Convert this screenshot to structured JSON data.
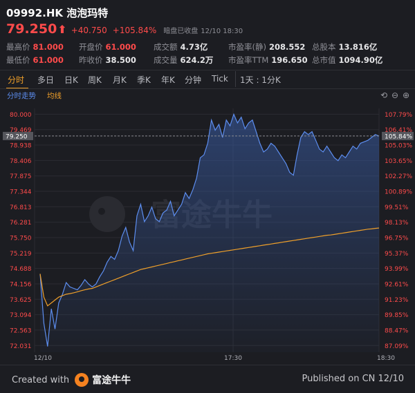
{
  "header": {
    "title": "09992.HK 泡泡玛特",
    "price": "79.250",
    "change": "+40.750",
    "change_pct": "+105.84%",
    "status": "暗盘已收盘",
    "timestamp": "12/10 18:30"
  },
  "stats": [
    {
      "label": "最高价",
      "value": "81.000",
      "red": true
    },
    {
      "label": "开盘价",
      "value": "61.000",
      "red": true
    },
    {
      "label": "成交额",
      "value": "4.73亿",
      "red": false
    },
    {
      "label": "市盈率(静)",
      "value": "208.552",
      "red": false
    },
    {
      "label": "总股本",
      "value": "13.816亿",
      "red": false
    },
    {
      "label": "最低价",
      "value": "61.000",
      "red": true
    },
    {
      "label": "昨收价",
      "value": "38.500",
      "red": false
    },
    {
      "label": "成交量",
      "value": "624.2万",
      "red": false
    },
    {
      "label": "市盈率TTM",
      "value": "196.650",
      "red": false
    },
    {
      "label": "总市值",
      "value": "1094.90亿",
      "red": false
    }
  ],
  "tabs": [
    "分时",
    "多日",
    "日K",
    "周K",
    "月K",
    "季K",
    "年K",
    "分钟",
    "Tick"
  ],
  "period_selector": "1天 : 1分K",
  "legend": {
    "series1": "分时走势",
    "series2": "均线"
  },
  "colors": {
    "up": "#ff4b4b",
    "price_line": "#5d8ef0",
    "avg_line": "#f0a02a",
    "accent": "#f0a02a"
  },
  "watermark": "富途牛牛",
  "footer": {
    "created_with": "Created with",
    "brand": "富途牛牛",
    "published": "Published on CN 12/10"
  },
  "chart_data": {
    "type": "line",
    "title": "",
    "xlabel": "",
    "ylabel": "",
    "ylim": [
      71.8,
      80.2
    ],
    "prev_close": 38.5,
    "grid": true,
    "current_price": "79.250",
    "current_pct": "105.84%",
    "x_ticks": [
      "12/10",
      "17:30",
      "18:30"
    ],
    "y_ticks_left": [
      "80.000",
      "79.469",
      "78.938",
      "78.406",
      "77.875",
      "77.344",
      "76.813",
      "76.281",
      "75.750",
      "75.219",
      "74.688",
      "74.156",
      "73.625",
      "73.094",
      "72.563",
      "72.031"
    ],
    "y_ticks_right": [
      "107.79%",
      "106.41%",
      "105.03%",
      "103.65%",
      "102.27%",
      "100.89%",
      "99.51%",
      "98.13%",
      "96.75%",
      "95.37%",
      "93.99%",
      "92.61%",
      "91.23%",
      "89.85%",
      "88.47%",
      "87.09%"
    ],
    "series": [
      {
        "name": "分时走势",
        "values": [
          74.5,
          72.8,
          72.0,
          73.3,
          72.6,
          73.5,
          73.8,
          74.2,
          74.05,
          74.0,
          73.95,
          74.1,
          74.3,
          74.15,
          74.05,
          74.15,
          74.4,
          74.6,
          74.9,
          75.1,
          75.0,
          75.3,
          75.8,
          76.1,
          75.6,
          75.3,
          76.5,
          76.9,
          76.3,
          76.5,
          76.8,
          76.4,
          76.3,
          76.6,
          76.7,
          77.0,
          76.5,
          76.7,
          76.9,
          77.3,
          77.1,
          77.4,
          77.8,
          78.5,
          78.6,
          79.0,
          79.8,
          79.45,
          79.65,
          79.2,
          79.8,
          79.6,
          80.0,
          79.7,
          79.9,
          79.5,
          79.7,
          79.8,
          79.4,
          79.0,
          78.7,
          78.8,
          79.0,
          78.9,
          78.7,
          78.5,
          78.3,
          78.0,
          77.9,
          78.6,
          79.2,
          79.4,
          79.3,
          79.4,
          79.1,
          78.8,
          78.7,
          78.9,
          78.7,
          78.5,
          78.4,
          78.6,
          78.5,
          78.7,
          78.9,
          78.8,
          79.0,
          79.05,
          79.1,
          79.2,
          79.3,
          79.25
        ]
      },
      {
        "name": "均线",
        "values": [
          74.5,
          73.7,
          73.4,
          73.5,
          73.6,
          73.7,
          73.75,
          73.8,
          73.82,
          73.85,
          73.88,
          73.92,
          73.95,
          73.98,
          74.0,
          74.05,
          74.1,
          74.15,
          74.2,
          74.25,
          74.3,
          74.35,
          74.4,
          74.45,
          74.5,
          74.55,
          74.6,
          74.65,
          74.68,
          74.71,
          74.74,
          74.77,
          74.8,
          74.83,
          74.86,
          74.89,
          74.92,
          74.95,
          74.98,
          75.01,
          75.04,
          75.07,
          75.1,
          75.13,
          75.16,
          75.19,
          75.21,
          75.23,
          75.25,
          75.27,
          75.29,
          75.31,
          75.33,
          75.35,
          75.37,
          75.39,
          75.41,
          75.43,
          75.45,
          75.47,
          75.49,
          75.51,
          75.53,
          75.55,
          75.57,
          75.59,
          75.61,
          75.63,
          75.65,
          75.67,
          75.69,
          75.71,
          75.73,
          75.75,
          75.77,
          75.79,
          75.81,
          75.83,
          75.84,
          75.86,
          75.88,
          75.9,
          75.92,
          75.94,
          75.96,
          75.98,
          76.0,
          76.02,
          76.04,
          76.05,
          76.07,
          76.08
        ]
      }
    ]
  }
}
